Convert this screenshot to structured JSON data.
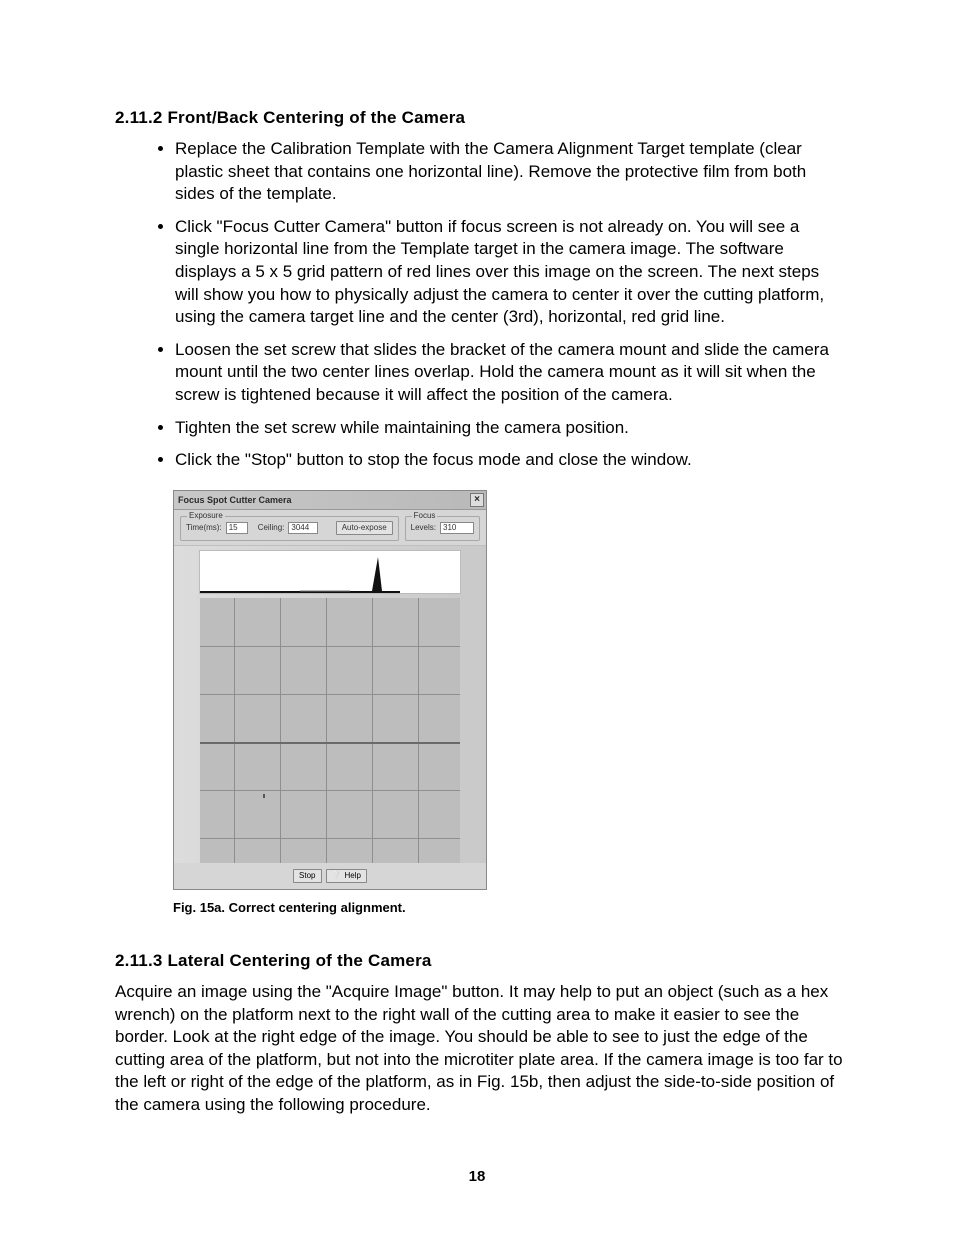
{
  "section1": {
    "heading": "2.11.2  Front/Back Centering of the Camera",
    "bullets": [
      "Replace the Calibration Template with the Camera Alignment Target template (clear plastic sheet that contains one horizontal line). Remove the protective film from both sides of the template.",
      "Click \"Focus Cutter Camera\" button if focus screen is not already on. You will see a single horizontal line from the Template target in the camera image. The software displays a 5 x 5 grid pattern of red lines over this image on the screen. The next steps will show you how to physically adjust the camera to center it over the cutting platform, using the camera target line and the center (3rd), horizontal, red grid line.",
      "Loosen the set screw that slides the bracket of the camera mount and slide the camera mount until the two center lines overlap. Hold the camera mount as it will sit when the screw is tightened because it will affect the position of the camera.",
      "Tighten the set screw while maintaining the camera position.",
      "Click the \"Stop\" button to stop the focus mode and close the window."
    ]
  },
  "figure": {
    "window_title": "Focus Spot Cutter Camera",
    "exposure_label": "Exposure",
    "time_label": "Time(ms):",
    "time_value": "15",
    "ceiling_label": "Ceiling:",
    "ceiling_value": "3044",
    "auto_expose_label": "Auto-expose",
    "focus_label": "Focus",
    "levels_label": "Levels:",
    "levels_value": "310",
    "stop_label": "Stop",
    "help_label": "Help",
    "caption": "Fig. 15a.  Correct centering alignment."
  },
  "section2": {
    "heading": "2.11.3  Lateral Centering of the Camera",
    "paragraph": "Acquire an image using the \"Acquire Image\" button. It may help to put an object (such as a hex wrench) on the platform next to the right wall of the cutting area to make it easier to see the border. Look at the right edge of the image. You should be able to see to just the edge of the cutting area of the platform, but not into the microtiter plate area. If the camera image is too far to the left or right of the edge of the platform, as in Fig. 15b, then adjust the side-to-side position of the camera using the following procedure."
  },
  "page_number": "18"
}
